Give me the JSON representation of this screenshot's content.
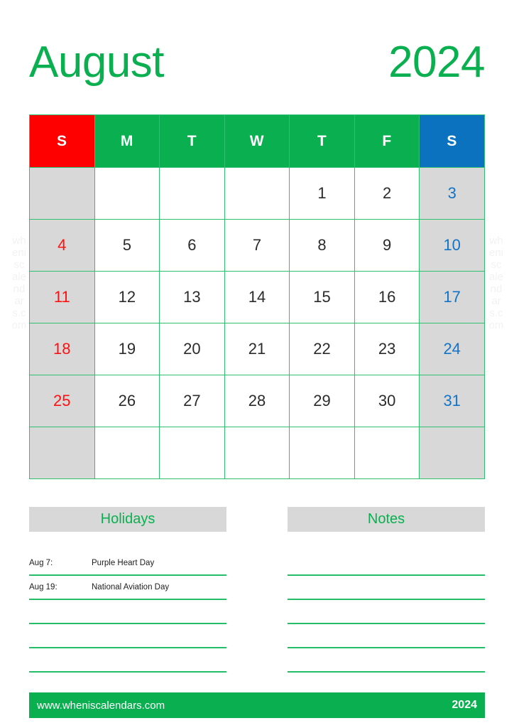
{
  "title": {
    "month": "August",
    "year": "2024"
  },
  "colors": {
    "green": "#0ab04f",
    "grid_green": "#2ec06e",
    "sunday_red": "#ff0000",
    "saturday_blue": "#0b72bf",
    "weekend_cell_gray": "#d8d8d8",
    "day_text": "#2b2b2b",
    "sunday_text": "#ff1111",
    "saturday_text": "#1273c7"
  },
  "weekdays": [
    {
      "label": "S",
      "kind": "sun"
    },
    {
      "label": "M",
      "kind": "weekday"
    },
    {
      "label": "T",
      "kind": "weekday"
    },
    {
      "label": "W",
      "kind": "weekday"
    },
    {
      "label": "T",
      "kind": "weekday"
    },
    {
      "label": "F",
      "kind": "weekday"
    },
    {
      "label": "S",
      "kind": "sat"
    }
  ],
  "weeks": [
    [
      "",
      "",
      "",
      "",
      "1",
      "2",
      "3"
    ],
    [
      "4",
      "5",
      "6",
      "7",
      "8",
      "9",
      "10"
    ],
    [
      "11",
      "12",
      "13",
      "14",
      "15",
      "16",
      "17"
    ],
    [
      "18",
      "19",
      "20",
      "21",
      "22",
      "23",
      "24"
    ],
    [
      "25",
      "26",
      "27",
      "28",
      "29",
      "30",
      "31"
    ],
    [
      "",
      "",
      "",
      "",
      "",
      "",
      ""
    ]
  ],
  "holidays": {
    "header": "Holidays",
    "rows": [
      {
        "date": "Aug 7:",
        "name": "Purple Heart Day"
      },
      {
        "date": "Aug 19:",
        "name": "National Aviation Day"
      },
      {
        "date": "",
        "name": ""
      },
      {
        "date": "",
        "name": ""
      },
      {
        "date": "",
        "name": ""
      }
    ]
  },
  "notes": {
    "header": "Notes",
    "rows": [
      {
        "date": "",
        "name": ""
      },
      {
        "date": "",
        "name": ""
      },
      {
        "date": "",
        "name": ""
      },
      {
        "date": "",
        "name": ""
      },
      {
        "date": "",
        "name": ""
      }
    ]
  },
  "watermark": {
    "text": "wheniscalendars.com"
  },
  "footer": {
    "url": "www.wheniscalendars.com",
    "year": "2024"
  }
}
